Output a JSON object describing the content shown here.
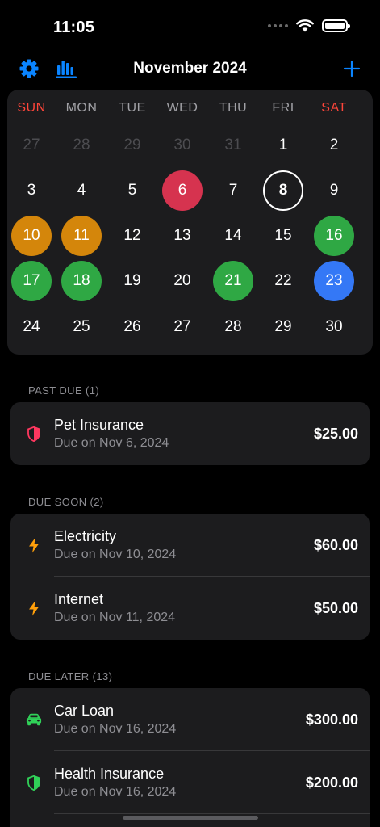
{
  "status_bar": {
    "time": "11:05"
  },
  "header": {
    "title": "November 2024"
  },
  "calendar": {
    "weekdays": [
      "SUN",
      "MON",
      "TUE",
      "WED",
      "THU",
      "FRI",
      "SAT"
    ],
    "weeks": [
      [
        {
          "d": "27",
          "s": "dim"
        },
        {
          "d": "28",
          "s": "dim"
        },
        {
          "d": "29",
          "s": "dim"
        },
        {
          "d": "30",
          "s": "dim"
        },
        {
          "d": "31",
          "s": "dim"
        },
        {
          "d": "1",
          "s": ""
        },
        {
          "d": "2",
          "s": ""
        }
      ],
      [
        {
          "d": "3",
          "s": ""
        },
        {
          "d": "4",
          "s": ""
        },
        {
          "d": "5",
          "s": ""
        },
        {
          "d": "6",
          "s": "red"
        },
        {
          "d": "7",
          "s": ""
        },
        {
          "d": "8",
          "s": "today"
        },
        {
          "d": "9",
          "s": ""
        }
      ],
      [
        {
          "d": "10",
          "s": "orange"
        },
        {
          "d": "11",
          "s": "orange"
        },
        {
          "d": "12",
          "s": ""
        },
        {
          "d": "13",
          "s": ""
        },
        {
          "d": "14",
          "s": ""
        },
        {
          "d": "15",
          "s": ""
        },
        {
          "d": "16",
          "s": "green"
        }
      ],
      [
        {
          "d": "17",
          "s": "green"
        },
        {
          "d": "18",
          "s": "green"
        },
        {
          "d": "19",
          "s": ""
        },
        {
          "d": "20",
          "s": ""
        },
        {
          "d": "21",
          "s": "green"
        },
        {
          "d": "22",
          "s": ""
        },
        {
          "d": "23",
          "s": "blue"
        }
      ],
      [
        {
          "d": "24",
          "s": ""
        },
        {
          "d": "25",
          "s": ""
        },
        {
          "d": "26",
          "s": ""
        },
        {
          "d": "27",
          "s": ""
        },
        {
          "d": "28",
          "s": ""
        },
        {
          "d": "29",
          "s": ""
        },
        {
          "d": "30",
          "s": ""
        }
      ]
    ]
  },
  "sections": {
    "past_due": {
      "header": "PAST DUE (1)",
      "items": [
        {
          "icon": "shield-icon",
          "icon_color": "#ff375f",
          "title": "Pet Insurance",
          "due": "Due on Nov 6, 2024",
          "amount": "$25.00"
        }
      ]
    },
    "due_soon": {
      "header": "DUE SOON (2)",
      "items": [
        {
          "icon": "bolt-icon",
          "icon_color": "#ff9f0a",
          "title": "Electricity",
          "due": "Due on Nov 10, 2024",
          "amount": "$60.00"
        },
        {
          "icon": "bolt-icon",
          "icon_color": "#ff9f0a",
          "title": "Internet",
          "due": "Due on Nov 11, 2024",
          "amount": "$50.00"
        }
      ]
    },
    "due_later": {
      "header": "DUE LATER (13)",
      "items": [
        {
          "icon": "car-icon",
          "icon_color": "#30d158",
          "title": "Car Loan",
          "due": "Due on Nov 16, 2024",
          "amount": "$300.00"
        },
        {
          "icon": "shield-icon",
          "icon_color": "#30d158",
          "title": "Health Insurance",
          "due": "Due on Nov 16, 2024",
          "amount": "$200.00"
        }
      ]
    }
  },
  "colors": {
    "accent": "#0a84ff",
    "weekend": "#ff453a",
    "past_due": "#d6334f",
    "due_soon": "#d4860b",
    "due_later": "#2fa844",
    "selected": "#3478f6"
  }
}
